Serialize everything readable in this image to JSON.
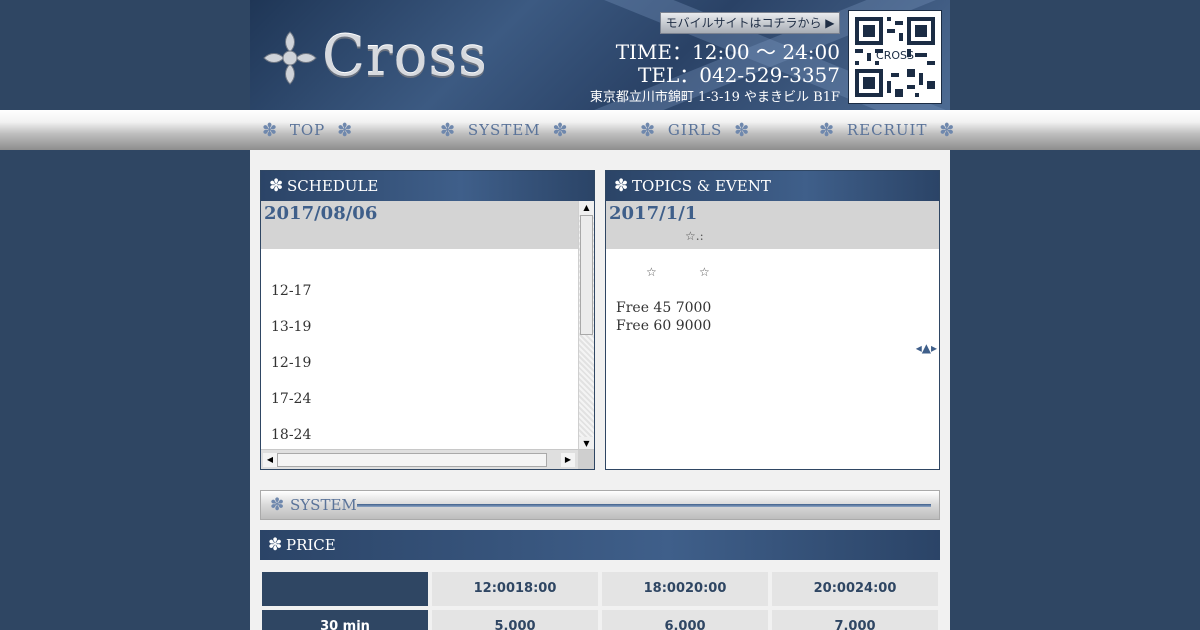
{
  "header": {
    "logo_text": "Cross",
    "mobile_link": "モバイルサイトはコチラから ▶",
    "time": "TIME：12:00 〜 24:00",
    "tel": "TEL：042-529-3357",
    "address": "東京都立川市錦町 1-3-19 やまきビル B1F",
    "qr_label": "CROSS"
  },
  "nav": {
    "items": [
      {
        "label": "TOP"
      },
      {
        "label": "SYSTEM"
      },
      {
        "label": "GIRLS"
      },
      {
        "label": "RECRUIT"
      }
    ],
    "icon": "✽"
  },
  "schedule": {
    "title": "SCHEDULE",
    "date": "2017/08/06",
    "rows": [
      "12-17",
      "13-19",
      "12-19",
      "17-24",
      "18-24"
    ]
  },
  "topics": {
    "title": "TOPICS & EVENT",
    "date": "2017/1/1",
    "star_line": "☆.:",
    "stars_a": "☆",
    "stars_b": "☆",
    "lines": [
      "Free 45 7000",
      "Free 60 9000"
    ],
    "nav_arrows": "◂▲▸"
  },
  "system": {
    "title": "SYSTEM"
  },
  "price": {
    "title": "PRICE",
    "columns": [
      "12:0018:00",
      "18:0020:00",
      "20:0024:00"
    ],
    "rows": [
      {
        "label": "30 min",
        "values": [
          "5,000",
          "6,000",
          "7,000"
        ]
      }
    ]
  },
  "colors": {
    "background": "#2f4663",
    "accent": "#3f5f8a",
    "panel_bg": "#f1f1f1"
  }
}
